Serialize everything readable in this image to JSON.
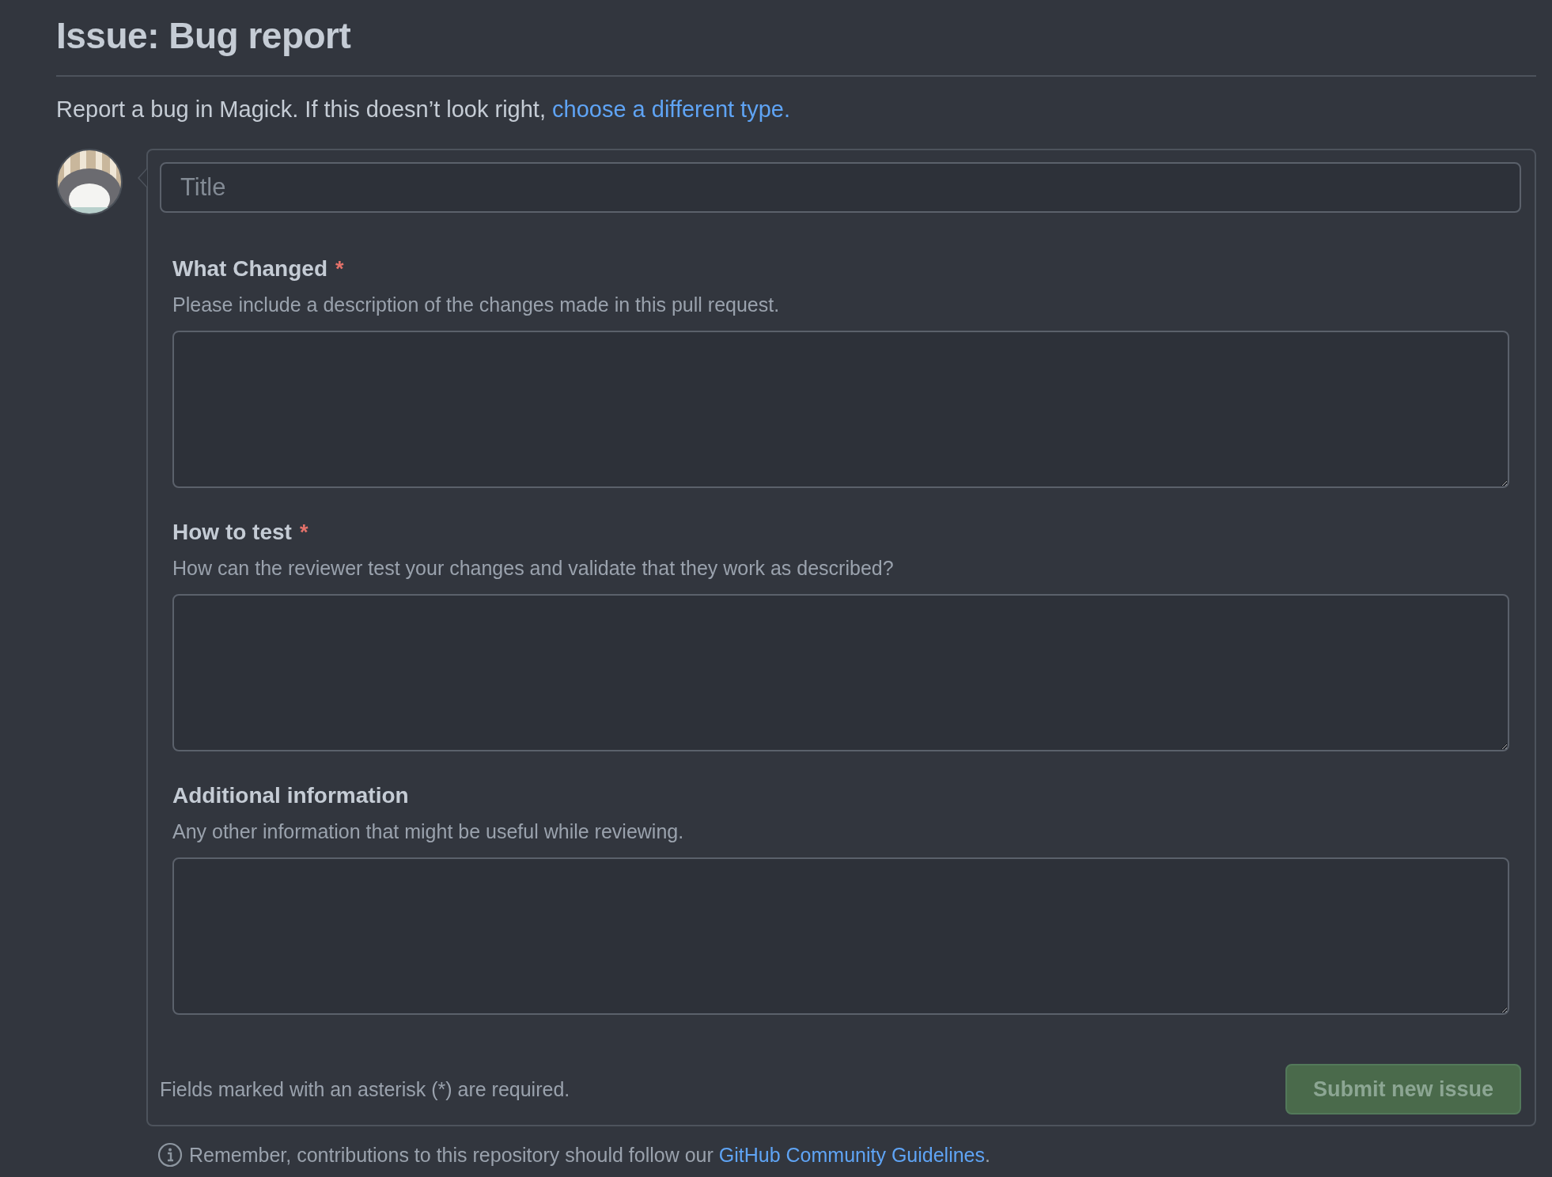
{
  "heading": "Issue: Bug report",
  "intro": {
    "text": "Report a bug in Magick. If this doesn’t look right, ",
    "link": "choose a different type."
  },
  "title_field": {
    "placeholder": "Title"
  },
  "required_marker": "*",
  "fields": [
    {
      "label": "What Changed",
      "required": true,
      "description": "Please include a description of the changes made in this pull request."
    },
    {
      "label": "How to test",
      "required": true,
      "description": "How can the reviewer test your changes and validate that they work as described?"
    },
    {
      "label": "Additional information",
      "required": false,
      "description": "Any other information that might be useful while reviewing."
    }
  ],
  "footer_note": "Fields marked with an asterisk (*) are required.",
  "submit_button": {
    "label": "Submit new issue",
    "disabled": true
  },
  "reminder": {
    "text": "Remember, contributions to this repository should follow our ",
    "link": "GitHub Community Guidelines",
    "end": "."
  }
}
